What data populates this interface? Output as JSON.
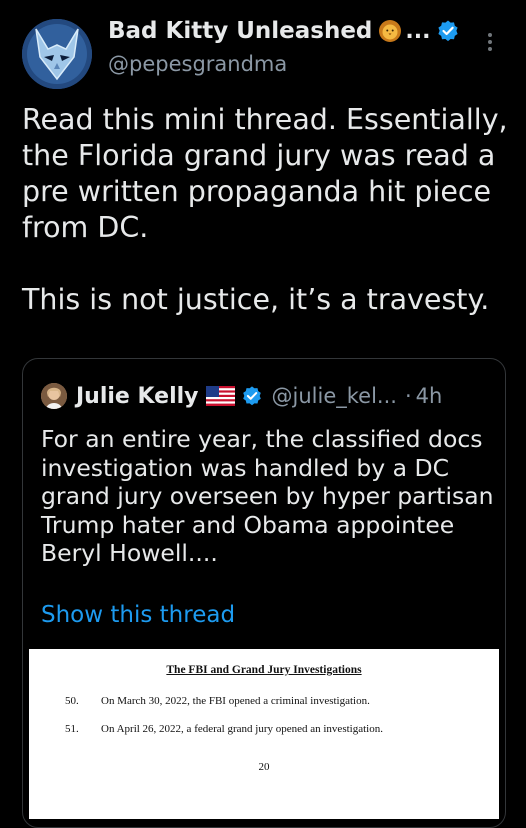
{
  "tweet": {
    "author_name": "Bad Kitty Unleashed",
    "name_truncation": "...",
    "author_handle": "@pepesgrandma",
    "paragraphs": [
      "Read this mini thread. Essentially, the Florida grand jury was read a pre written propaganda hit piece from DC.",
      "This is not justice, it’s a travesty."
    ]
  },
  "quoted_tweet": {
    "author_name": "Julie Kelly",
    "author_handle": "@julie_kel...",
    "separator": "·",
    "timestamp": "4h",
    "text": "For an entire year, the classified docs investigation was handled by a DC grand jury overseen by hyper partisan Trump hater and Obama appointee Beryl Howell....",
    "show_thread_label": "Show this thread",
    "document": {
      "heading": "The FBI and Grand Jury Investigations",
      "items": [
        {
          "number": "50.",
          "text": "On March 30, 2022, the FBI opened a criminal investigation."
        },
        {
          "number": "51.",
          "text": "On April 26, 2022, a federal grand jury opened an investigation."
        }
      ],
      "page_number": "20"
    }
  },
  "colors": {
    "background": "#000000",
    "text_primary": "#e7e9ea",
    "text_secondary": "#8b98a5",
    "link": "#1d9bf0",
    "verified": "#1d9bf0",
    "border": "#333639"
  },
  "icons": {
    "avatar": "masked-cat-avatar",
    "name_emoji": "lion-face-emoji",
    "verified": "verified-badge-icon",
    "more": "more-vertical-icon",
    "flag": "us-flag-emoji"
  }
}
